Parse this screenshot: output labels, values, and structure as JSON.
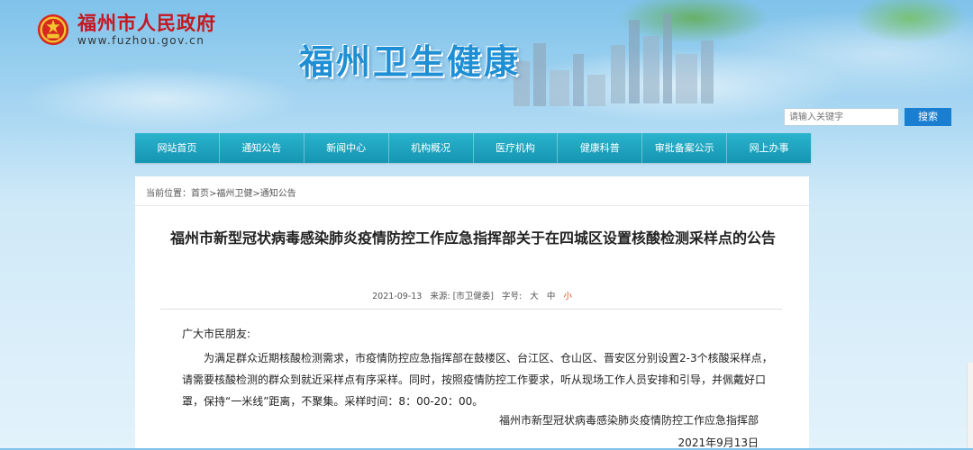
{
  "logo": {
    "title": "福州市人民政府",
    "url": "www.fuzhou.gov.cn",
    "icon": "national-emblem-icon"
  },
  "banner": {
    "title": "福州卫生健康"
  },
  "search": {
    "placeholder": "请输入关键字",
    "button_label": "搜索"
  },
  "nav": {
    "items": [
      {
        "label": "网站首页"
      },
      {
        "label": "通知公告"
      },
      {
        "label": "新闻中心"
      },
      {
        "label": "机构概况"
      },
      {
        "label": "医疗机构"
      },
      {
        "label": "健康科普"
      },
      {
        "label": "审批备案公示"
      },
      {
        "label": "网上办事"
      }
    ]
  },
  "breadcrumb": {
    "text": "当前位置：首页>福州卫健>通知公告"
  },
  "article": {
    "title": "福州市新型冠状病毒感染肺炎疫情防控工作应急指挥部关于在四城区设置核酸检测采样点的公告",
    "date": "2021-09-13",
    "source": "来源: [市卫健委]",
    "font_size_label": "字号:",
    "font_sizes": {
      "large": "大",
      "medium": "中",
      "small": "小"
    },
    "greeting": "广大市民朋友:",
    "paragraph": "为满足群众近期核酸检测需求，市疫情防控应急指挥部在鼓楼区、台江区、仓山区、晋安区分别设置2-3个核酸采样点，请需要核酸检测的群众到就近采样点有序采样。同时，按照疫情防控工作要求，听从现场工作人员安排和引导，并佩戴好口罩，保持“一米线”距离，不聚集。采样时间：8：00-20：00。",
    "signature_org": "福州市新型冠状病毒感染肺炎疫情防控工作应急指挥部",
    "signature_date": "2021年9月13日"
  },
  "colors": {
    "nav": "#1ea5c0",
    "logo_red": "#c5171f",
    "banner_title": "#1e8fd4",
    "search_button": "#1a7fd0",
    "small_font_link": "#e24b17"
  }
}
